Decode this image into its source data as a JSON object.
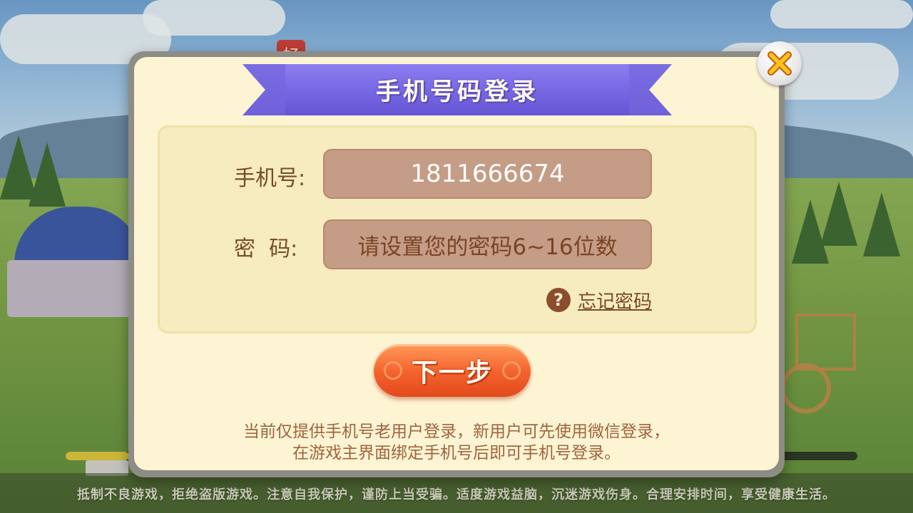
{
  "background": {
    "logo_char": "好",
    "health_notice": "抵制不良游戏，拒绝盗版游戏。注意自我保护，谨防上当受骗。适度游戏益脑，沉迷游戏伤身。合理安排时间，享受健康生活。",
    "loading_progress": 0.08
  },
  "dialog": {
    "title": "手机号码登录",
    "close_icon": "close-icon",
    "phone": {
      "label": "手机号:",
      "value": "1811666674"
    },
    "password": {
      "label": "密  码:",
      "placeholder": "请设置您的密码6~16位数"
    },
    "forgot": {
      "icon": "?",
      "label": "忘记密码"
    },
    "next_button": "下一步",
    "note_line1": "当前仅提供手机号老用户登录，新用户可先使用微信登录，",
    "note_line2": "在游戏主界面绑定手机号后即可手机号登录。"
  },
  "colors": {
    "dialog_bg": "#fdf4d4",
    "ribbon": "#7c6fe0",
    "input_bg": "#c59c85",
    "button": "#f3612c",
    "text_brown": "#7a4a2a"
  }
}
